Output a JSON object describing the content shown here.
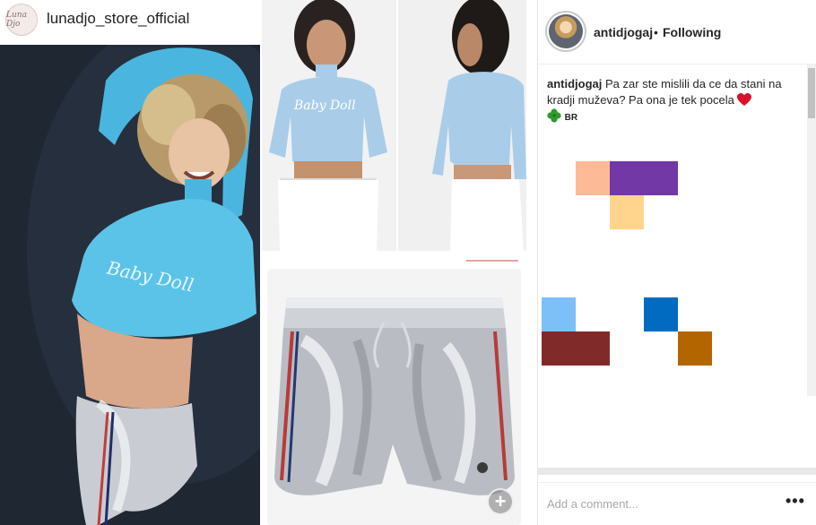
{
  "post": {
    "store_logo_text": "Luna Djo",
    "store_name": "lunadjo_store_official",
    "print_text": "Baby Doll"
  },
  "panel": {
    "username": "antidjogaj",
    "separator": "•",
    "follow_status": "Following",
    "caption_user": "antidjogaj",
    "caption_text": "Pa zar ste mislili da ce da stani na kradji muževa? Pa ona je tek pocela",
    "caption_tag": "BR",
    "comment_placeholder": "Add a comment...",
    "more_label": "•••"
  },
  "colors": {
    "shirt_blue": "#5cc3e8",
    "shirt_light_blue": "#a9cde9",
    "pixel_peach": "#fcbb96",
    "pixel_purple": "#7138a6",
    "pixel_sand": "#ffd48d",
    "pixel_sky": "#7dbff7",
    "pixel_maroon": "#802a2a",
    "pixel_cobalt": "#006bc0",
    "pixel_ochre": "#b36600"
  },
  "icons": {
    "heart": "heart-icon",
    "clover": "clover-icon",
    "zoom": "zoom-plus-icon",
    "more": "more-options-icon"
  }
}
